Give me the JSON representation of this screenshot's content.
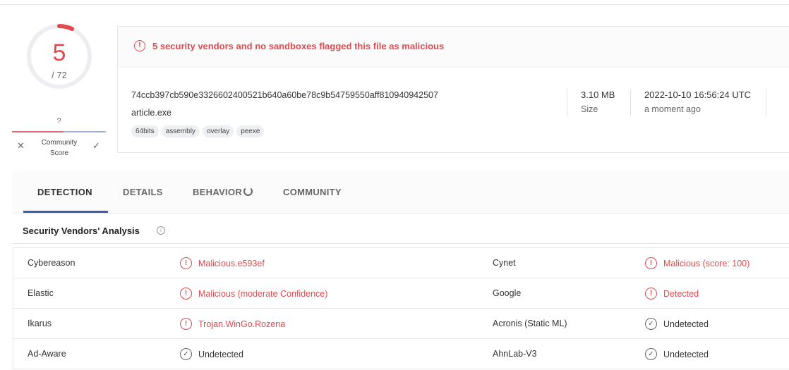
{
  "score": {
    "malicious": "5",
    "total": "/ 72",
    "fraction": 0.069,
    "accent_color": "#e04b50",
    "community_value": "?",
    "community_label": "Community Score",
    "dislike_icon": "close-icon",
    "like_icon": "check-icon"
  },
  "summary": {
    "banner": "5 security vendors and no sandboxes flagged this file as malicious",
    "hash": "74ccb397cb590e3326602400521b640a60be78c9b54759550aff810940942507",
    "filename": "article.exe",
    "tags": [
      "64bits",
      "assembly",
      "overlay",
      "peexe"
    ],
    "size_value": "3.10 MB",
    "size_label": "Size",
    "date_value": "2022-10-10 16:56:24 UTC",
    "date_label": "a moment ago"
  },
  "tabs": [
    {
      "label": "DETECTION",
      "active": true
    },
    {
      "label": "DETAILS",
      "active": false
    },
    {
      "label": "BEHAVIOR",
      "active": false
    },
    {
      "label": "COMMUNITY",
      "active": false
    }
  ],
  "section_title": "Security Vendors' Analysis",
  "vendors": [
    {
      "left_name": "Cybereason",
      "left_result": "Malicious.e593ef",
      "left_status": "malicious",
      "right_name": "Cynet",
      "right_result": "Malicious (score: 100)",
      "right_status": "malicious"
    },
    {
      "left_name": "Elastic",
      "left_result": "Malicious (moderate Confidence)",
      "left_status": "malicious",
      "right_name": "Google",
      "right_result": "Detected",
      "right_status": "malicious"
    },
    {
      "left_name": "Ikarus",
      "left_result": "Trojan.WinGo.Rozena",
      "left_status": "malicious",
      "right_name": "Acronis (Static ML)",
      "right_result": "Undetected",
      "right_status": "undetected"
    },
    {
      "left_name": "Ad-Aware",
      "left_result": "Undetected",
      "left_status": "undetected",
      "right_name": "AhnLab-V3",
      "right_result": "Undetected",
      "right_status": "undetected"
    }
  ]
}
